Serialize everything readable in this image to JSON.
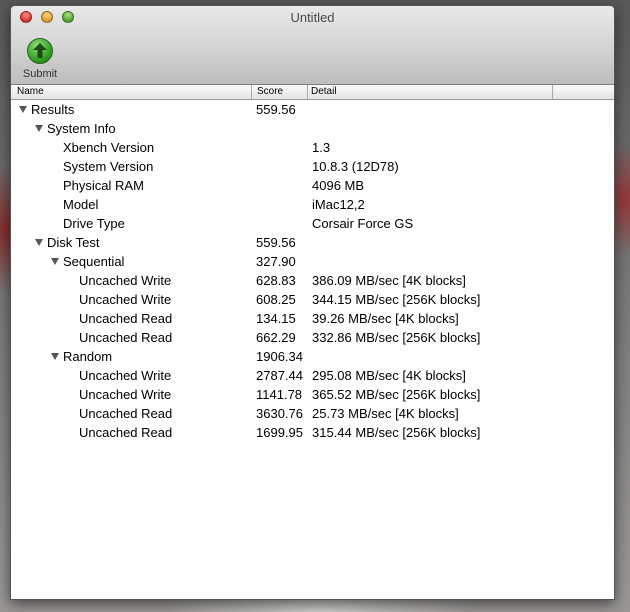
{
  "window": {
    "title": "Untitled"
  },
  "toolbar": {
    "submit_label": "Submit",
    "submit_icon": "up-arrow-circle-icon"
  },
  "columns": {
    "name": "Name",
    "score": "Score",
    "detail": "Detail"
  },
  "rows": [
    {
      "name": "Results",
      "score": "559.56",
      "detail": "",
      "level": 0,
      "expanded": true
    },
    {
      "name": "System Info",
      "score": "",
      "detail": "",
      "level": 1,
      "expanded": true
    },
    {
      "name": "Xbench Version",
      "score": "",
      "detail": "1.3",
      "level": 2
    },
    {
      "name": "System Version",
      "score": "",
      "detail": "10.8.3 (12D78)",
      "level": 2
    },
    {
      "name": "Physical RAM",
      "score": "",
      "detail": "4096 MB",
      "level": 2
    },
    {
      "name": "Model",
      "score": "",
      "detail": "iMac12,2",
      "level": 2
    },
    {
      "name": "Drive Type",
      "score": "",
      "detail": "Corsair Force GS",
      "level": 2
    },
    {
      "name": "Disk Test",
      "score": "559.56",
      "detail": "",
      "level": 1,
      "expanded": true
    },
    {
      "name": "Sequential",
      "score": "327.90",
      "detail": "",
      "level": 2,
      "expanded": true
    },
    {
      "name": "Uncached Write",
      "score": "628.83",
      "detail": "386.09 MB/sec [4K blocks]",
      "level": 3
    },
    {
      "name": "Uncached Write",
      "score": "608.25",
      "detail": "344.15 MB/sec [256K blocks]",
      "level": 3
    },
    {
      "name": "Uncached Read",
      "score": "134.15",
      "detail": "39.26 MB/sec [4K blocks]",
      "level": 3
    },
    {
      "name": "Uncached Read",
      "score": "662.29",
      "detail": "332.86 MB/sec [256K blocks]",
      "level": 3
    },
    {
      "name": "Random",
      "score": "1906.34",
      "detail": "",
      "level": 2,
      "expanded": true
    },
    {
      "name": "Uncached Write",
      "score": "2787.44",
      "detail": "295.08 MB/sec [4K blocks]",
      "level": 3
    },
    {
      "name": "Uncached Write",
      "score": "1141.78",
      "detail": "365.52 MB/sec [256K blocks]",
      "level": 3
    },
    {
      "name": "Uncached Read",
      "score": "3630.76",
      "detail": "25.73 MB/sec [4K blocks]",
      "level": 3
    },
    {
      "name": "Uncached Read",
      "score": "1699.95",
      "detail": "315.44 MB/sec [256K blocks]",
      "level": 3
    }
  ]
}
